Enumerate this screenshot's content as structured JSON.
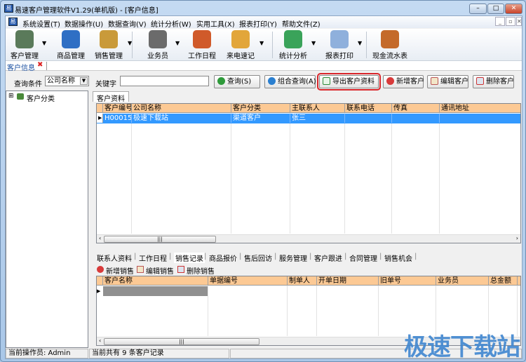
{
  "window": {
    "title": "易速客户管理软件V1.29(单机版) - [客户信息]",
    "minimize": "–",
    "maximize": "□",
    "close": "✕"
  },
  "menu": {
    "items": [
      "系统设置(T)",
      "数据操作(U)",
      "数据查询(V)",
      "统计分析(W)",
      "实用工具(X)",
      "报表打印(Y)",
      "帮助文件(Z)"
    ],
    "mdi": [
      "_",
      "▫",
      "✕"
    ]
  },
  "toolbar": {
    "items": [
      {
        "label": "客户管理",
        "icon": "customer-manage-icon",
        "color": "#5a7a5a",
        "dropdown": true
      },
      {
        "label": "商品管理",
        "icon": "goods-manage-icon",
        "color": "#2f6fc4",
        "dropdown": false
      },
      {
        "label": "销售管理",
        "icon": "sales-manage-icon",
        "color": "#c99a3a",
        "dropdown": true
      },
      {
        "label": "业务员",
        "icon": "salesman-icon",
        "color": "#6b6b6b",
        "dropdown": true
      },
      {
        "label": "工作日程",
        "icon": "schedule-icon",
        "color": "#d05a2a",
        "dropdown": false
      },
      {
        "label": "来电速记",
        "icon": "call-note-icon",
        "color": "#e2a63a",
        "dropdown": true
      },
      {
        "label": "统计分析",
        "icon": "pie-chart-icon",
        "color": "#3aa35a",
        "dropdown": true
      },
      {
        "label": "报表打印",
        "icon": "report-print-icon",
        "color": "#8fb0dc",
        "dropdown": true
      },
      {
        "label": "现金流水表",
        "icon": "cash-flow-icon",
        "color": "#c46a2a",
        "dropdown": false
      }
    ]
  },
  "doc_tab": {
    "label": "客户信息",
    "close": "✖"
  },
  "query": {
    "condition_label": "查询条件",
    "condition_value": "公司名称",
    "keyword_label": "关键字",
    "keyword_value": "",
    "buttons": {
      "search": "查询(S)",
      "combo": "组合查询(A)",
      "export": "导出客户资料",
      "add": "新增客户",
      "edit": "编辑客户",
      "delete": "删除客户"
    }
  },
  "tree": {
    "expander": "⊞",
    "root": "客户分类"
  },
  "main_tab": "客户资料",
  "customer_grid": {
    "columns": [
      "客户编号",
      "公司名称",
      "客户分类",
      "主联系人",
      "联系电话",
      "传真",
      "通讯地址"
    ],
    "rows": [
      [
        "H000157",
        "极速下载站",
        "渠道客户",
        "张三",
        "",
        "",
        ""
      ]
    ]
  },
  "bottom_tabs": [
    "联系人资料",
    "工作日程",
    "销售记录",
    "商品报价",
    "售后回访",
    "服务管理",
    "客户跟进",
    "合同管理",
    "销售机会"
  ],
  "active_bottom_tab": "销售记录",
  "sales_toolbar": {
    "add": "新增销售",
    "edit": "编辑销售",
    "delete": "删除销售"
  },
  "sales_grid": {
    "columns": [
      "客户名称",
      "单据编号",
      "制单人",
      "开单日期",
      "旧单号",
      "业务员",
      "总金额"
    ],
    "rows": []
  },
  "scroll_grip": "|||",
  "status": {
    "operator": "当前操作员: Admin",
    "records": "当前共有 9 条客户记录"
  },
  "watermark": "极速下载站",
  "colors": {
    "header": "#fcc994",
    "selection": "#3399ff",
    "export_highlight": "#d9262b"
  }
}
